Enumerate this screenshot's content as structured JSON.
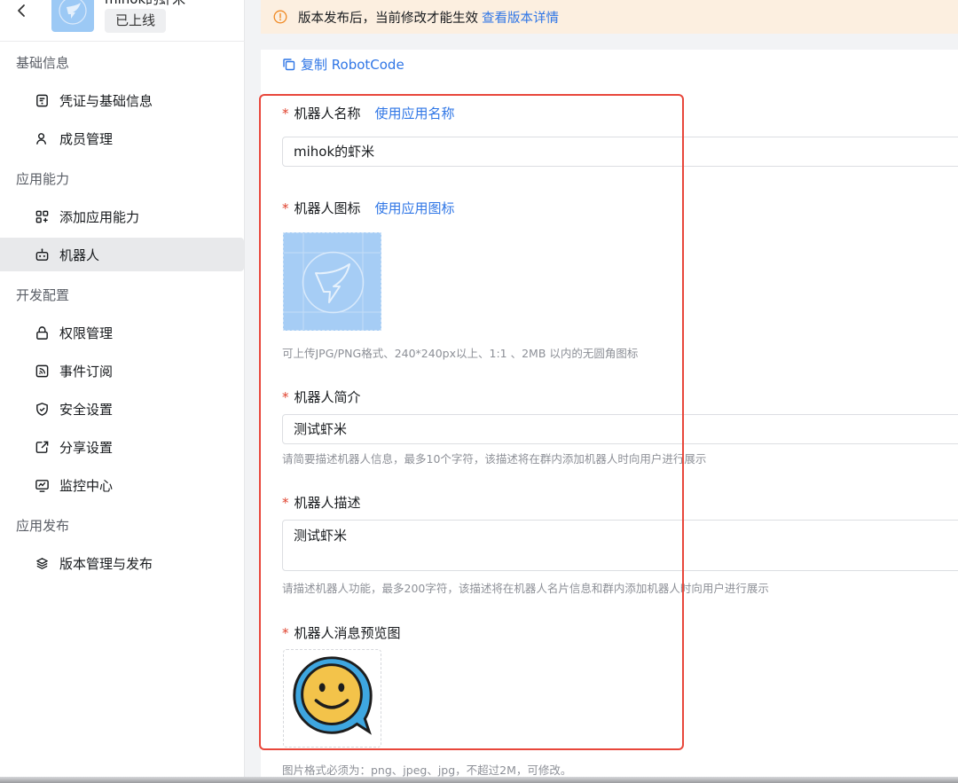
{
  "app": {
    "name": "mihok的虾米",
    "status": "已上线"
  },
  "sidebar": {
    "groups": [
      {
        "title": "基础信息",
        "items": [
          {
            "label": "凭证与基础信息",
            "icon": "credential-icon"
          },
          {
            "label": "成员管理",
            "icon": "member-icon"
          }
        ]
      },
      {
        "title": "应用能力",
        "items": [
          {
            "label": "添加应用能力",
            "icon": "add-capability-icon"
          },
          {
            "label": "机器人",
            "icon": "robot-icon",
            "active": true
          }
        ]
      },
      {
        "title": "开发配置",
        "items": [
          {
            "label": "权限管理",
            "icon": "lock-icon"
          },
          {
            "label": "事件订阅",
            "icon": "rss-icon"
          },
          {
            "label": "安全设置",
            "icon": "shield-icon"
          },
          {
            "label": "分享设置",
            "icon": "share-icon"
          },
          {
            "label": "监控中心",
            "icon": "monitor-icon"
          }
        ]
      },
      {
        "title": "应用发布",
        "items": [
          {
            "label": "版本管理与发布",
            "icon": "layers-icon"
          }
        ]
      }
    ]
  },
  "banner": {
    "text": "版本发布后，当前修改才能生效",
    "link": "查看版本详情"
  },
  "form": {
    "copy_link": "复制 RobotCode",
    "required_mark": "*",
    "name": {
      "label": "机器人名称",
      "action": "使用应用名称",
      "value": "mihok的虾米"
    },
    "icon": {
      "label": "机器人图标",
      "action": "使用应用图标",
      "hint": "可上传JPG/PNG格式、240*240px以上、1:1 、2MB 以内的无圆角图标"
    },
    "intro": {
      "label": "机器人简介",
      "value": "测试虾米",
      "hint": "请简要描述机器人信息，最多10个字符，该描述将在群内添加机器人时向用户进行展示"
    },
    "description": {
      "label": "机器人描述",
      "value": "测试虾米",
      "hint": "请描述机器人功能，最多200字符，该描述将在机器人名片信息和群内添加机器人时向用户进行展示"
    },
    "preview": {
      "label": "机器人消息预览图",
      "hint": "图片格式必须为：png、jpeg、jpg，不超过2M，可修改。"
    }
  },
  "colors": {
    "accent": "#2f76e6",
    "required": "#e0422e",
    "highlight": "#e8473b",
    "banner_bg": "#fcefe0"
  }
}
